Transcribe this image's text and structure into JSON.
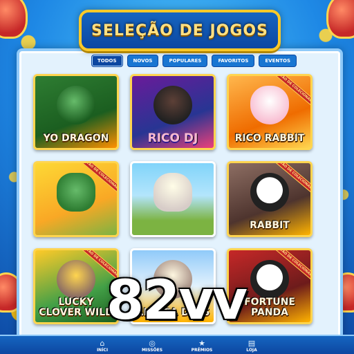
{
  "header": {
    "title": "SELEÇÃO DE JOGOS"
  },
  "tabs": [
    {
      "label": "TODOS",
      "active": true
    },
    {
      "label": "NOVOS"
    },
    {
      "label": "POPULARES"
    },
    {
      "label": "FAVORITOS"
    },
    {
      "label": "EVENTOS"
    }
  ],
  "games": [
    {
      "title": "YO DRAGON",
      "art": "dragon"
    },
    {
      "title": "RICO DJ",
      "art": "gorilla-dj"
    },
    {
      "title": "RICO RABBIT",
      "art": "bunny",
      "ribbon": "CARTÃO DE COLECIONADOR"
    },
    {
      "title": "",
      "art": "clover-horseshoe",
      "ribbon": "CARTÃO DE COLECIONADOR"
    },
    {
      "title": "",
      "art": "alpaca-sombrero"
    },
    {
      "title": "RABBIT",
      "art": "panda-coins",
      "ribbon": "CARTÃO DE COLECIONADOR"
    },
    {
      "title": "LUCKY CLOVER WILD",
      "art": "gold-pot",
      "ribbon": "CARTÃO DE COLECIONADOR"
    },
    {
      "title": "ALPACA DAYS",
      "art": "alpaca"
    },
    {
      "title": "FORTUNE PANDA",
      "art": "panda",
      "ribbon": "CARTÃO DE COLECIONADOR"
    }
  ],
  "bottom_nav": [
    {
      "label": "INÍCI",
      "icon": "home-icon",
      "glyph": "⌂"
    },
    {
      "label": "MISSÕES",
      "icon": "target-icon",
      "glyph": "◎"
    },
    {
      "label": "PRÊMIOS",
      "icon": "trophy-icon",
      "glyph": "★"
    },
    {
      "label": "LOJA",
      "icon": "shop-icon",
      "glyph": "▤"
    }
  ],
  "watermark": "82vv",
  "colors": {
    "accent": "#1976d2",
    "gold": "#ffca28",
    "panel": "#e3f2fd"
  }
}
